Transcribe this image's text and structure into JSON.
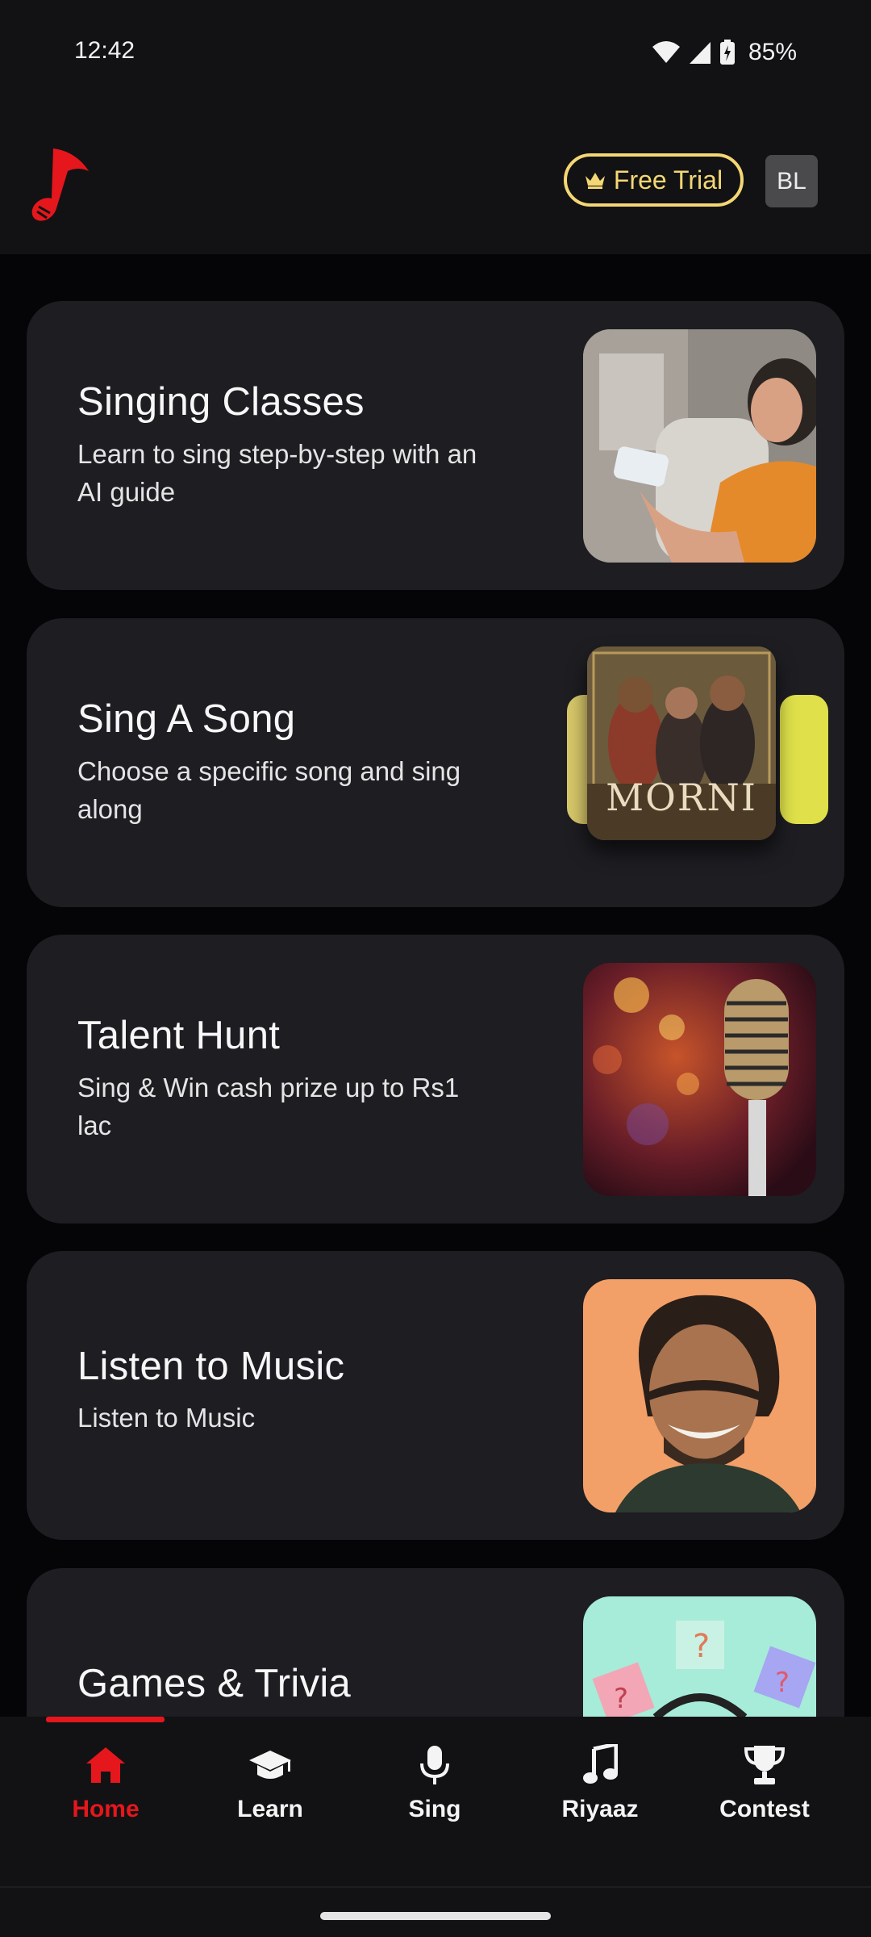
{
  "status_bar": {
    "time": "12:42",
    "battery": "85%"
  },
  "header": {
    "free_trial_label": "Free Trial",
    "avatar_initials": "BL"
  },
  "cards": [
    {
      "title": "Singing Classes",
      "subtitle": "Learn to sing step-by-step with an AI guide"
    },
    {
      "title": "Sing A Song",
      "subtitle": "Choose a specific song and sing along",
      "album_title": "MORNI"
    },
    {
      "title": "Talent Hunt",
      "subtitle": "Sing & Win cash prize up to Rs1 lac"
    },
    {
      "title": "Listen to Music",
      "subtitle": "Listen to Music"
    },
    {
      "title": "Games & Trivia"
    }
  ],
  "bottom_nav": [
    {
      "label": "Home",
      "icon": "home-icon",
      "active": true
    },
    {
      "label": "Learn",
      "icon": "graduation-cap-icon",
      "active": false
    },
    {
      "label": "Sing",
      "icon": "microphone-icon",
      "active": false
    },
    {
      "label": "Riyaaz",
      "icon": "music-note-icon",
      "active": false
    },
    {
      "label": "Contest",
      "icon": "trophy-icon",
      "active": false
    }
  ],
  "colors": {
    "accent": "#e5171c",
    "trial": "#f4d774",
    "card": "#1d1d22",
    "bar": "#121214"
  }
}
